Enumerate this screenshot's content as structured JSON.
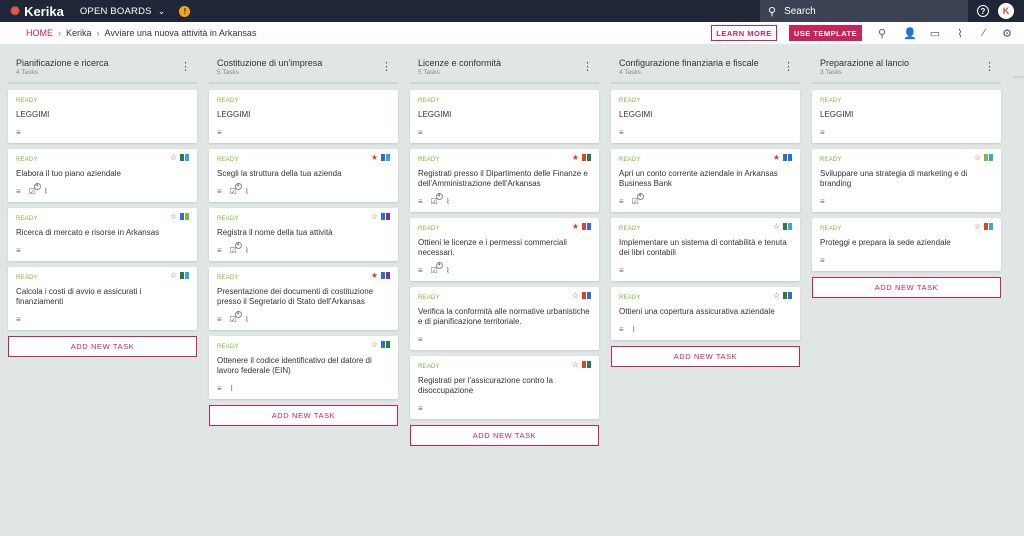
{
  "topbar": {
    "app_name": "Kerika",
    "open_boards_label": "OPEN BOARDS",
    "notification_count": "!",
    "search_placeholder": "Search",
    "avatar_letter": "K"
  },
  "subbar": {
    "breadcrumb": [
      "HOME",
      "Kerika",
      "Avviare una nuova attività in Arkansas"
    ],
    "learn_more_label": "LEARN MORE",
    "use_template_label": "USE TEMPLATE"
  },
  "colors": {
    "accent": "#c8235a",
    "ready_green": "#7fba3a",
    "flag_red": "#d9442c",
    "flag_blue": "#2a6fd6",
    "flag_lightblue": "#3ba3dd",
    "flag_green": "#2d7a3d",
    "flag_purple": "#6a3ea1",
    "flag_lightgreen": "#7fba3a"
  },
  "add_task_label": "ADD NEW TASK",
  "columns": [
    {
      "title": "Pianificazione e ricerca",
      "count": "4 Tasks",
      "cards": [
        {
          "status": "READY",
          "title": "LEGGIMI",
          "icons": [
            "desc"
          ],
          "star": "",
          "flags": []
        },
        {
          "status": "READY",
          "title": "Elabora il tuo piano aziendale",
          "icons": [
            "desc",
            "check",
            "attach"
          ],
          "check_count": "4",
          "star": "outline",
          "flags": [
            "flag_green",
            "flag_lightblue"
          ]
        },
        {
          "status": "READY",
          "title": "Ricerca di mercato e risorse in Arkansas",
          "icons": [
            "desc"
          ],
          "star": "outline",
          "flags": [
            "flag_blue",
            "flag_lightgreen"
          ]
        },
        {
          "status": "READY",
          "title": "Calcola i costi di avvio e assicurati i finanziamenti",
          "icons": [
            "desc"
          ],
          "star": "outline",
          "flags": [
            "flag_green",
            "flag_lightblue"
          ]
        }
      ]
    },
    {
      "title": "Costituzione di un'impresa",
      "count": "5 Tasks",
      "cards": [
        {
          "status": "READY",
          "title": "LEGGIMI",
          "icons": [
            "desc"
          ],
          "star": "",
          "flags": []
        },
        {
          "status": "READY",
          "title": "Scegli la struttura della tua azienda",
          "icons": [
            "desc",
            "check",
            "attach"
          ],
          "check_count": "4",
          "star": "filled",
          "flags": [
            "flag_blue",
            "flag_lightblue"
          ]
        },
        {
          "status": "READY",
          "title": "Registra il nome della tua attività",
          "icons": [
            "desc",
            "check",
            "attach"
          ],
          "check_count": "4",
          "star": "outline",
          "flags": [
            "flag_blue",
            "flag_purple"
          ]
        },
        {
          "status": "READY",
          "title": "Presentazione dei documenti di costituzione presso il Segretario di Stato dell'Arkansas",
          "icons": [
            "desc",
            "check",
            "attach"
          ],
          "check_count": "4",
          "star": "filled",
          "flags": [
            "flag_blue",
            "flag_purple"
          ]
        },
        {
          "status": "READY",
          "title": "Ottenere il codice identificativo del datore di lavoro federale (EIN)",
          "icons": [
            "desc",
            "attach"
          ],
          "star": "outline",
          "flags": [
            "flag_blue",
            "flag_green"
          ]
        }
      ]
    },
    {
      "title": "Licenze e conformità",
      "count": "5 Tasks",
      "cards": [
        {
          "status": "READY",
          "title": "LEGGIMI",
          "icons": [
            "desc"
          ],
          "star": "",
          "flags": []
        },
        {
          "status": "READY",
          "title": "Registrati presso il Dipartimento delle Finanze e dell'Amministrazione dell'Arkansas",
          "icons": [
            "desc",
            "check",
            "attach"
          ],
          "check_count": "4",
          "star": "filled",
          "flags": [
            "flag_red",
            "flag_green"
          ]
        },
        {
          "status": "READY",
          "title": "Ottieni le licenze e i permessi commerciali necessari.",
          "icons": [
            "desc",
            "check",
            "attach"
          ],
          "check_count": "4",
          "star": "filled",
          "flags": [
            "flag_red",
            "flag_blue"
          ]
        },
        {
          "status": "READY",
          "title": "Verifica la conformità alle normative urbanistiche e di pianificazione territoriale.",
          "icons": [
            "desc"
          ],
          "star": "outline",
          "flags": [
            "flag_red",
            "flag_blue"
          ]
        },
        {
          "status": "READY",
          "title": "Registrati per l'assicurazione contro la disoccupazione",
          "icons": [
            "desc"
          ],
          "star": "outline",
          "flags": [
            "flag_red",
            "flag_green"
          ]
        }
      ]
    },
    {
      "title": "Configurazione finanziaria e fiscale",
      "count": "4 Tasks",
      "cards": [
        {
          "status": "READY",
          "title": "LEGGIMI",
          "icons": [
            "desc"
          ],
          "star": "",
          "flags": []
        },
        {
          "status": "READY",
          "title": "Apri un conto corrente aziendale in Arkansas Business Bank",
          "icons": [
            "desc",
            "check"
          ],
          "check_count": "4",
          "star": "filled",
          "flags": [
            "flag_blue",
            "flag_blue"
          ]
        },
        {
          "status": "READY",
          "title": "Implementare un sistema di contabilità e tenuta dei libri contabili",
          "icons": [
            "desc"
          ],
          "star": "outline",
          "flags": [
            "flag_green",
            "flag_lightblue"
          ]
        },
        {
          "status": "READY",
          "title": "Ottieni una copertura assicurativa aziendale",
          "icons": [
            "desc",
            "attach"
          ],
          "star": "outline",
          "flags": [
            "flag_green",
            "flag_blue"
          ]
        }
      ]
    },
    {
      "title": "Preparazione al lancio",
      "count": "3 Tasks",
      "cards": [
        {
          "status": "READY",
          "title": "LEGGIMI",
          "icons": [
            "desc"
          ],
          "star": "",
          "flags": []
        },
        {
          "status": "READY",
          "title": "Sviluppare una strategia di marketing e di branding",
          "icons": [
            "desc"
          ],
          "star": "outline",
          "flags": [
            "flag_lightgreen",
            "flag_lightblue"
          ]
        },
        {
          "status": "READY",
          "title": "Proteggi e prepara la sede aziendale",
          "icons": [
            "desc"
          ],
          "star": "outline",
          "flags": [
            "flag_red",
            "flag_lightblue"
          ]
        }
      ]
    }
  ]
}
